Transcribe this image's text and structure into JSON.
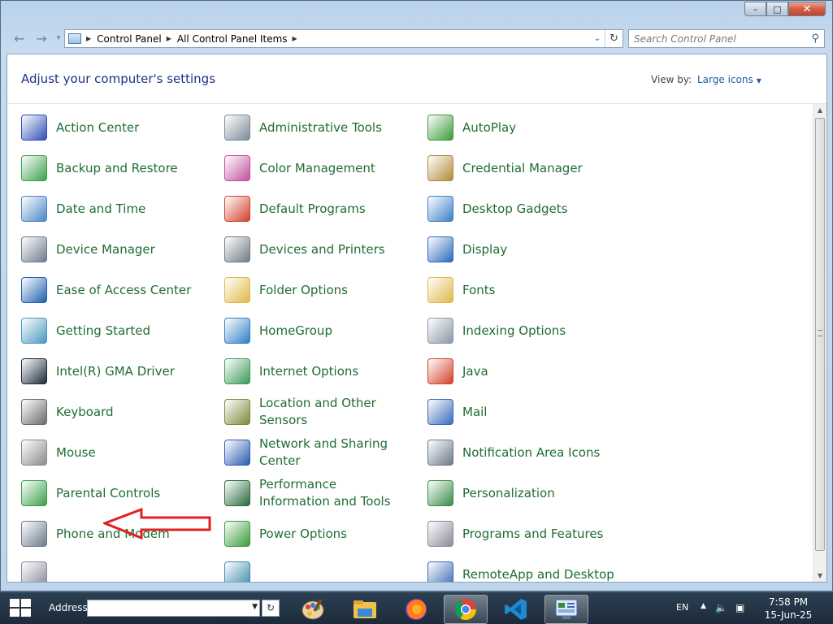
{
  "window": {
    "caption_buttons": {
      "minimize": "–",
      "maximize": "□",
      "close": "✕"
    }
  },
  "nav": {
    "back_icon": "←",
    "forward_icon": "→",
    "breadcrumb": [
      "Control Panel",
      "All Control Panel Items"
    ],
    "refresh_icon": "↻",
    "search_placeholder": "Search Control Panel"
  },
  "header": {
    "title": "Adjust your computer's settings",
    "view_by_label": "View by:",
    "view_by_value": "Large icons"
  },
  "items": [
    {
      "label": "Action Center",
      "icon": "flag-icon",
      "color": "#2e4fb5"
    },
    {
      "label": "Administrative Tools",
      "icon": "admin-tools-icon",
      "color": "#7c8a99"
    },
    {
      "label": "AutoPlay",
      "icon": "autoplay-icon",
      "color": "#3a9a3a"
    },
    {
      "label": "Backup and Restore",
      "icon": "backup-icon",
      "color": "#3aa04a"
    },
    {
      "label": "Color Management",
      "icon": "color-management-icon",
      "color": "#c04f9a"
    },
    {
      "label": "Credential Manager",
      "icon": "credential-icon",
      "color": "#b08a3a"
    },
    {
      "label": "Date and Time",
      "icon": "calendar-icon",
      "color": "#4a86c8"
    },
    {
      "label": "Default Programs",
      "icon": "default-programs-icon",
      "color": "#d2402a"
    },
    {
      "label": "Desktop Gadgets",
      "icon": "gadgets-icon",
      "color": "#3b7fc4"
    },
    {
      "label": "Device Manager",
      "icon": "device-manager-icon",
      "color": "#6c7c8c"
    },
    {
      "label": "Devices and Printers",
      "icon": "printer-icon",
      "color": "#707a86"
    },
    {
      "label": "Display",
      "icon": "display-icon",
      "color": "#2a6ab8"
    },
    {
      "label": "Ease of Access Center",
      "icon": "ease-of-access-icon",
      "color": "#1f5fb0"
    },
    {
      "label": "Folder Options",
      "icon": "folder-icon",
      "color": "#e0b846"
    },
    {
      "label": "Fonts",
      "icon": "fonts-icon",
      "color": "#e0b846"
    },
    {
      "label": "Getting Started",
      "icon": "getting-started-icon",
      "color": "#4a98c0"
    },
    {
      "label": "HomeGroup",
      "icon": "homegroup-icon",
      "color": "#2f7fc4"
    },
    {
      "label": "Indexing Options",
      "icon": "indexing-icon",
      "color": "#8a97a5"
    },
    {
      "label": "Intel(R) GMA Driver",
      "icon": "intel-gma-icon",
      "color": "#1c2a3a"
    },
    {
      "label": "Internet Options",
      "icon": "internet-options-icon",
      "color": "#3a9a5a"
    },
    {
      "label": "Java",
      "icon": "java-icon",
      "color": "#d2402a"
    },
    {
      "label": "Keyboard",
      "icon": "keyboard-icon",
      "color": "#6a6a6a"
    },
    {
      "label": "Location and Other Sensors",
      "icon": "location-icon",
      "color": "#7a8a3a"
    },
    {
      "label": "Mail",
      "icon": "mail-icon",
      "color": "#3a6ab8"
    },
    {
      "label": "Mouse",
      "icon": "mouse-icon",
      "color": "#8a8a8a"
    },
    {
      "label": "Network and Sharing Center",
      "icon": "network-icon",
      "color": "#2a5ab0"
    },
    {
      "label": "Notification Area Icons",
      "icon": "notification-area-icon",
      "color": "#6a7a8a"
    },
    {
      "label": "Parental Controls",
      "icon": "parental-controls-icon",
      "color": "#3aa04a"
    },
    {
      "label": "Performance Information and Tools",
      "icon": "performance-icon",
      "color": "#2a6a3a"
    },
    {
      "label": "Personalization",
      "icon": "personalization-icon",
      "color": "#3a8a4a"
    },
    {
      "label": "Phone and Modem",
      "icon": "phone-icon",
      "color": "#6a7a8a"
    },
    {
      "label": "Power Options",
      "icon": "power-icon",
      "color": "#3a9a3a"
    },
    {
      "label": "Programs and Features",
      "icon": "programs-features-icon",
      "color": "#8a8a9a"
    },
    {
      "label": "",
      "icon": "partial-icon",
      "color": "#8a8a9a"
    },
    {
      "label": "",
      "icon": "partial-icon",
      "color": "#3a8aaa"
    },
    {
      "label": "RemoteApp and Desktop",
      "icon": "remoteapp-icon",
      "color": "#3a6ab8"
    }
  ],
  "taskbar": {
    "address_label": "Address",
    "address_value": "",
    "apps": [
      "paint-icon",
      "file-explorer-icon",
      "firefox-icon",
      "chrome-icon",
      "vscode-icon",
      "control-panel-icon"
    ],
    "language": "EN",
    "time": "7:58 PM",
    "date": "15-Jun-25"
  },
  "annotation": {
    "arrow_color": "#e02020"
  }
}
